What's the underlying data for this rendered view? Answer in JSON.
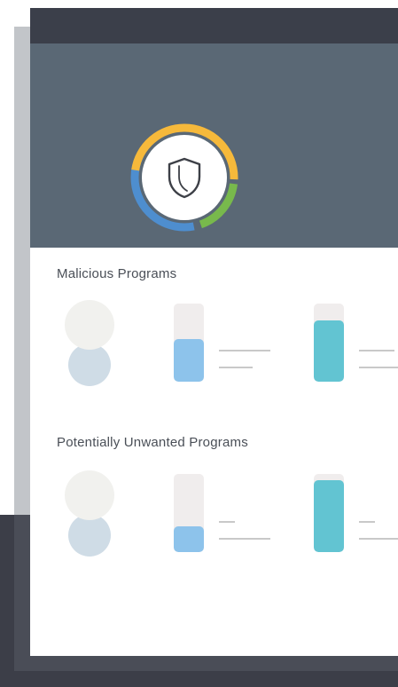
{
  "sections": [
    {
      "title": "Malicious Programs",
      "bars": [
        {
          "level": 0.55,
          "color": "#8dc3eb"
        },
        {
          "level": 0.78,
          "color": "#62c4d2"
        }
      ]
    },
    {
      "title": "Potentially Unwanted Programs",
      "bars": [
        {
          "level": 0.33,
          "color": "#8dc3eb"
        },
        {
          "level": 0.92,
          "color": "#62c4d2"
        }
      ]
    }
  ],
  "ring": {
    "icon": "shield-icon",
    "colors": {
      "yellow": "#f6b93b",
      "green": "#78b94c",
      "blue": "#4e8ecf"
    }
  },
  "colors": {
    "titlebar": "#3b3f4a",
    "header": "#5a6875",
    "background_dark": "#3c3e48",
    "background_gray": "#c2c5c9"
  }
}
